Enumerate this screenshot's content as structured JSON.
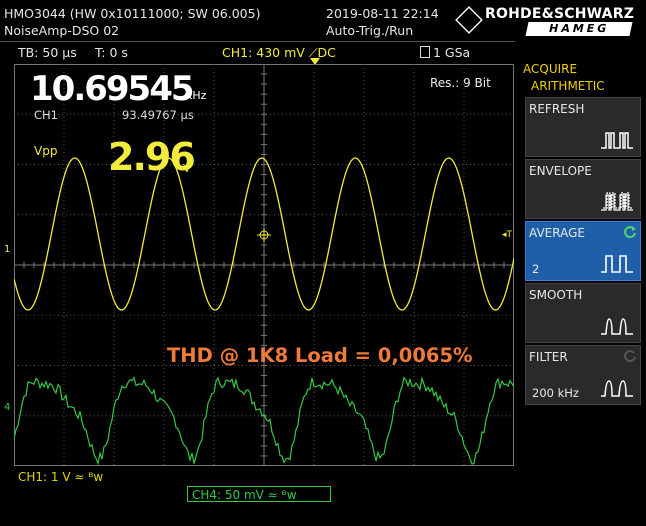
{
  "header": {
    "device": "HMO3044 (HW 0x10111000; SW 06.005)",
    "setup_name": "NoiseAmp-DSO 02",
    "datetime": "2019-08-11 22:14",
    "trigger_mode": "Auto-Trig./Run",
    "timebase": "TB: 50 µs",
    "trigger_time": "T: 0 s",
    "trigger_channel": "CH1: 430 mV ⟋DC",
    "sample_rate": "1 GSa",
    "logo_top": "ROHDE&SCHWARZ",
    "logo_bottom": "HAMEG"
  },
  "measurements": {
    "frequency_value": "10.69545",
    "frequency_unit": "kHz",
    "channel_label": "CH1",
    "period": "93.49767 µs",
    "resolution_label": "Res.: 9 Bit",
    "vpp_label": "Vpp",
    "vpp_value": "2.96",
    "vpp_unit": "V"
  },
  "annotation": "THD @ 1K8 Load = 0,0065%",
  "markers": {
    "ch1_marker": "1",
    "ch4_marker": "4",
    "trigger_marker": "T"
  },
  "footer": {
    "ch1_setting": "CH1: 1 V ≈ ᴮw",
    "ch4_setting": "CH4: 50 mV ≈ ᴮw"
  },
  "sidebar": {
    "title_line1": "ACQUIRE",
    "title_line2": "ARITHMETIC",
    "buttons": [
      {
        "label": "REFRESH",
        "value": ""
      },
      {
        "label": "ENVELOPE",
        "value": ""
      },
      {
        "label": "AVERAGE",
        "value": "2"
      },
      {
        "label": "SMOOTH",
        "value": ""
      },
      {
        "label": "FILTER",
        "value": "200 kHz"
      }
    ]
  },
  "colors": {
    "ch1": "#f2ec3c",
    "ch4": "#35c845",
    "annotation": "#f07a3a",
    "accent_yellow": "#f0d000",
    "active_button": "#1f5fa8"
  }
}
